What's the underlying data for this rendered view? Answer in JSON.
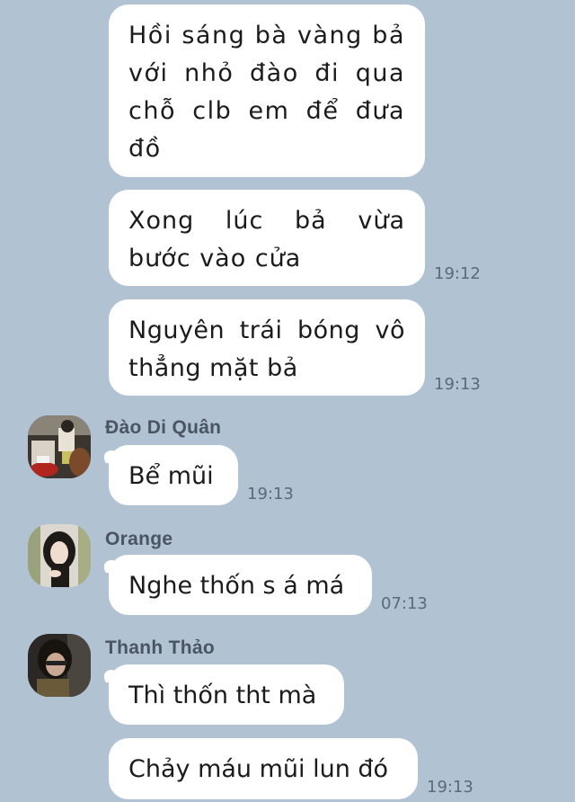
{
  "chat": {
    "messages": [
      {
        "text": "Hồi sáng bà vàng bả với nhỏ đào đi qua chỗ clb em để đưa đồ",
        "time": ""
      },
      {
        "text": "Xong lúc bả vừa bước vào cửa",
        "time": "19:12"
      },
      {
        "text": "Nguyên trái bóng vô thẳng mặt bả",
        "time": "19:13"
      },
      {
        "sender": "Đào Di Quân",
        "text": "Bể mũi",
        "time": "19:13",
        "avatar_icon": "avatar-photo"
      },
      {
        "sender": "Orange",
        "text": "Nghe thốn s á má",
        "time": "07:13",
        "avatar_icon": "avatar-photo"
      },
      {
        "sender": "Thanh Thảo",
        "text": "Thì thốn tht mà",
        "time": "",
        "avatar_icon": "avatar-photo"
      },
      {
        "text": "Chảy máu mũi lun đó",
        "time": "19:13"
      }
    ]
  },
  "colors": {
    "background": "#b1c2d3",
    "bubble": "#ffffff",
    "text": "#1b1b1b",
    "time": "#5b6978",
    "sender_name": "#4a5562"
  }
}
